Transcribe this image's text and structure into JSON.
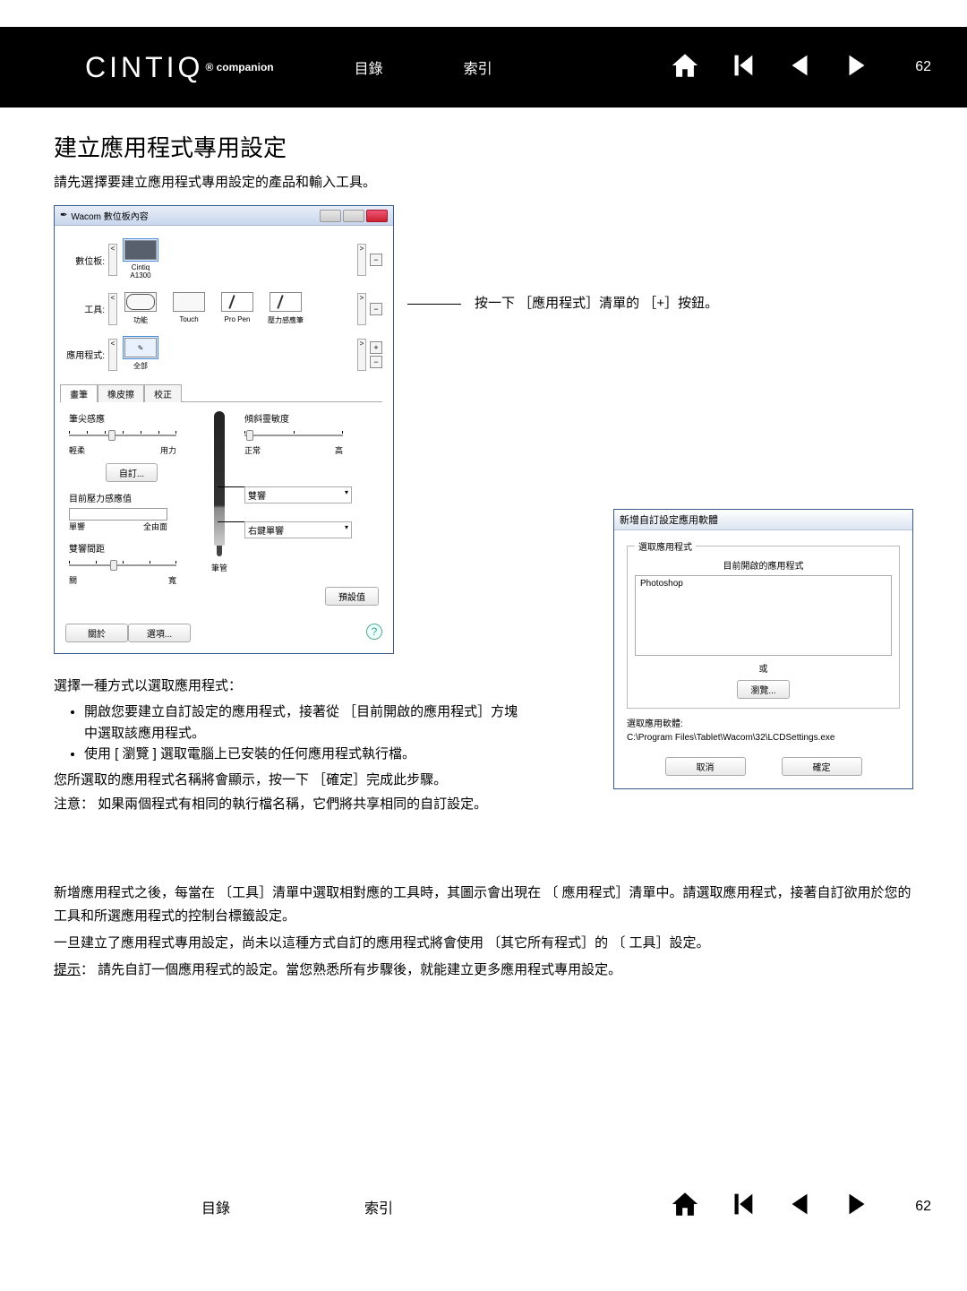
{
  "header": {
    "brand": "CINTIQ",
    "brand_suffix": "® companion",
    "link_toc": "目錄",
    "link_index": "索引",
    "page_no": "62"
  },
  "title": "建立應用程式專用設定",
  "lead": "請先選擇要建立應用程式專用設定的產品和輸入工具。",
  "win": {
    "title": "Wacom 數位板內容",
    "lbl_tablet": "數位板:",
    "item_tablet": "Cintiq A1300",
    "lbl_tool": "工具:",
    "tool_func": "功能",
    "tool_touch": "Touch",
    "tool_propen": "Pro Pen",
    "tool_pressure": "壓力感應筆",
    "lbl_app": "應用程式:",
    "item_all": "全部",
    "tab_pen": "畫筆",
    "tab_eraser": "橡皮擦",
    "tab_calib": "校正",
    "tip_feel": "筆尖感應",
    "tilt_sens": "傾斜靈敏度",
    "soft": "輕柔",
    "firm": "用力",
    "normal": "正常",
    "high": "高",
    "custom": "自訂...",
    "cur_pressure": "目前壓力感應值",
    "click": "單響",
    "fullclick": "全由面",
    "dbl_tap_dist": "雙響間距",
    "off": "關",
    "large": "寬",
    "pen_lbl": "筆管",
    "combo_dbl": "雙響",
    "combo_rbtn": "右鍵單響",
    "default": "預設值",
    "about": "關於",
    "options": "選項...",
    "plus": "+",
    "minus": "−",
    "gt": ">",
    "lt": "<"
  },
  "callout_text": "按一下 ［應用程式］清單的 ［+］按鈕。",
  "instr": {
    "intro": "選擇一種方式以選取應用程式：",
    "b1": "開啟您要建立自訂設定的應用程式，接著從 ［目前開啟的應用程式］方塊 中選取該應用程式。",
    "b2": "使用 [ 瀏覽 ] 選取電腦上已安裝的任何應用程式執行檔。",
    "p1": "您所選取的應用程式名稱將會顯示，按一下 ［確定］完成此步驟。",
    "p2": "注意： 如果兩個程式有相同的執行檔名稱，它們將共享相同的自訂設定。"
  },
  "dlg": {
    "title": "新增自訂設定應用軟體",
    "legend": "選取應用程式",
    "open_apps_lbl": "目前開啟的應用程式",
    "list_item": "Photoshop",
    "or": "或",
    "browse": "瀏覽...",
    "sel_app_lbl": "選取應用軟體:",
    "path": "C:\\Program Files\\Tablet\\Wacom\\32\\LCDSettings.exe",
    "cancel": "取消",
    "ok": "確定"
  },
  "body": {
    "p1": "新增應用程式之後，每當在 〔工具］清單中選取相對應的工具時，其圖示會出現在 〔 應用程式］清單中。請選取應用程式，接著自訂欲用於您的工具和所選應用程式的控制台標籤設定。",
    "p2": "一旦建立了應用程式專用設定，尚未以這種方式自訂的應用程式將會使用 〔其它所有程式］的 〔 工具］設定。",
    "tip_lbl": "提示",
    "tip_txt": "： 請先自訂一個應用程式的設定。當您熟悉所有步驟後，就能建立更多應用程式專用設定。"
  }
}
